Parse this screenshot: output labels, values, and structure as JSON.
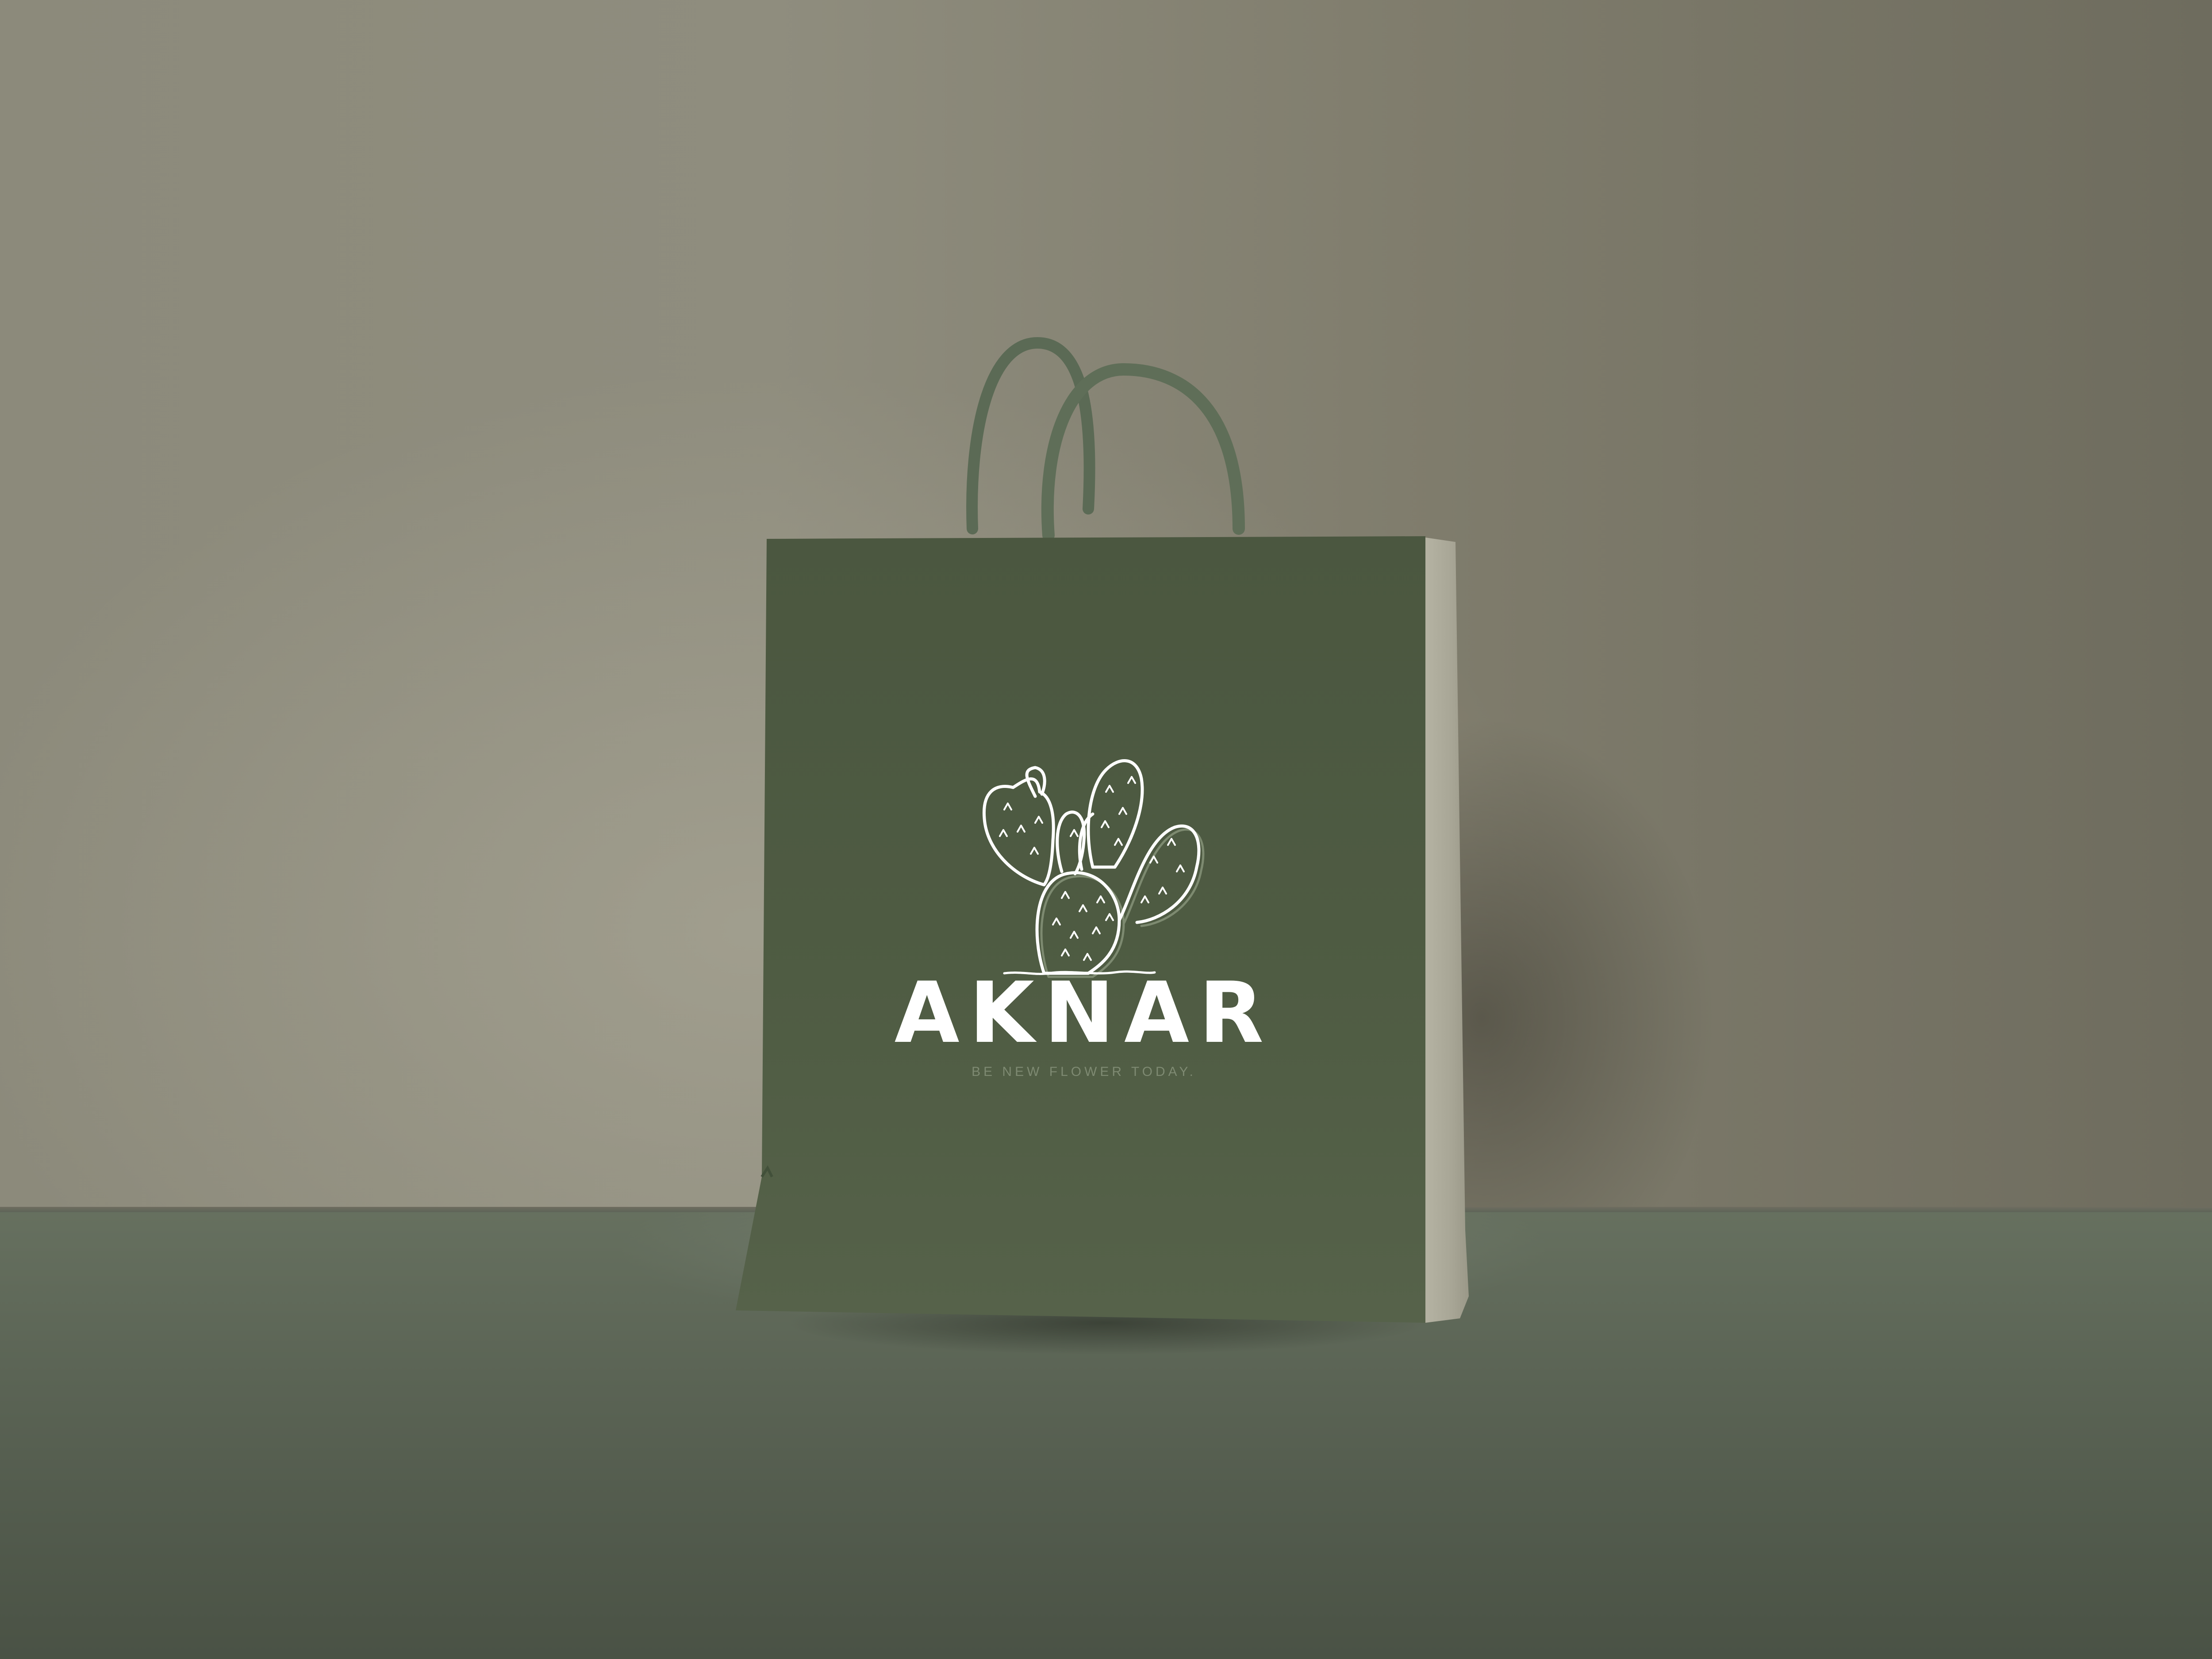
{
  "scene": {
    "subject": "paper-shopping-bag",
    "colors": {
      "wall": "#8d8b7d",
      "floor": "#5a6354",
      "bag_front": "#4d5a41",
      "bag_side": "#a9a798",
      "handle": "#5d6c57",
      "logo": "#ffffff",
      "tagline": "#7e8a72"
    }
  },
  "bag": {
    "brand_name": "AKNAR",
    "tagline": "BE NEW FLOWER TODAY.",
    "logo_icon": "cactus-icon"
  }
}
